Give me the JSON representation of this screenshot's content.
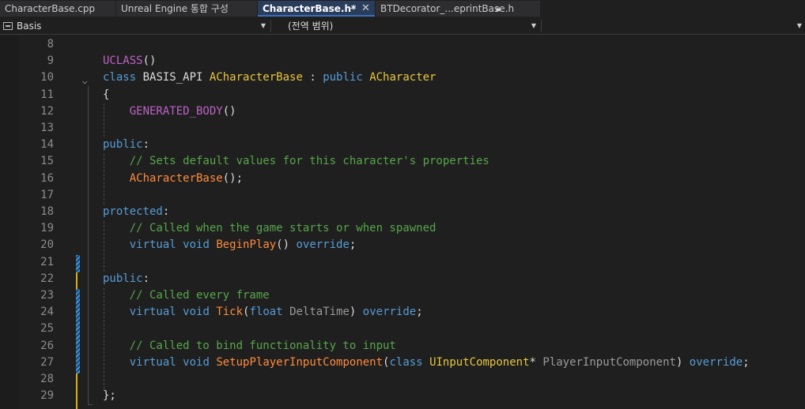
{
  "tabs": [
    {
      "label": "CharacterBase.cpp",
      "active": false
    },
    {
      "label": "Unreal Engine 통합 구성",
      "active": false
    },
    {
      "label": "CharacterBase.h*",
      "active": true
    },
    {
      "label": "BTDecorator_...eprintBase.h",
      "active": false
    }
  ],
  "tab_icons": {
    "pin": "pin-icon",
    "close": "close-icon",
    "lock": "lock-icon"
  },
  "nav": {
    "project": "Basis",
    "scope": "(전역 범위)",
    "member": ""
  },
  "code_lines": [
    {
      "n": "8",
      "tokens": []
    },
    {
      "n": "9",
      "tokens": [
        {
          "c": "mac",
          "t": "UCLASS"
        },
        {
          "c": "tx",
          "t": "()"
        }
      ]
    },
    {
      "n": "10",
      "tokens": [
        {
          "c": "kw",
          "t": "class"
        },
        {
          "c": "tx",
          "t": " BASIS_API "
        },
        {
          "c": "cls",
          "t": "ACharacterBase"
        },
        {
          "c": "tx",
          "t": " : "
        },
        {
          "c": "kw",
          "t": "public"
        },
        {
          "c": "tx",
          "t": " "
        },
        {
          "c": "cls",
          "t": "ACharacter"
        }
      ]
    },
    {
      "n": "11",
      "tokens": [
        {
          "c": "tx",
          "t": "{"
        }
      ]
    },
    {
      "n": "12",
      "tokens": [
        {
          "c": "mac",
          "t": "    GENERATED_BODY"
        },
        {
          "c": "tx",
          "t": "()"
        }
      ]
    },
    {
      "n": "13",
      "tokens": []
    },
    {
      "n": "14",
      "tokens": [
        {
          "c": "kw",
          "t": "public"
        },
        {
          "c": "tx",
          "t": ":"
        }
      ]
    },
    {
      "n": "15",
      "tokens": [
        {
          "c": "cm",
          "t": "    // Sets default values for this character's properties"
        }
      ]
    },
    {
      "n": "16",
      "tokens": [
        {
          "c": "fn",
          "t": "    ACharacterBase"
        },
        {
          "c": "tx",
          "t": "();"
        }
      ]
    },
    {
      "n": "17",
      "tokens": []
    },
    {
      "n": "18",
      "tokens": [
        {
          "c": "kw",
          "t": "protected"
        },
        {
          "c": "tx",
          "t": ":"
        }
      ]
    },
    {
      "n": "19",
      "tokens": [
        {
          "c": "cm",
          "t": "    // Called when the game starts or when spawned"
        }
      ]
    },
    {
      "n": "20",
      "tokens": [
        {
          "c": "kw",
          "t": "    virtual"
        },
        {
          "c": "tx",
          "t": " "
        },
        {
          "c": "kw",
          "t": "void"
        },
        {
          "c": "tx",
          "t": " "
        },
        {
          "c": "fn",
          "t": "BeginPlay"
        },
        {
          "c": "tx",
          "t": "() "
        },
        {
          "c": "kw",
          "t": "override"
        },
        {
          "c": "tx",
          "t": ";"
        }
      ]
    },
    {
      "n": "21",
      "tokens": []
    },
    {
      "n": "22",
      "tokens": [
        {
          "c": "kw",
          "t": "public"
        },
        {
          "c": "tx",
          "t": ":"
        }
      ]
    },
    {
      "n": "23",
      "tokens": [
        {
          "c": "cm",
          "t": "    // Called every frame"
        }
      ]
    },
    {
      "n": "24",
      "tokens": [
        {
          "c": "kw",
          "t": "    virtual"
        },
        {
          "c": "tx",
          "t": " "
        },
        {
          "c": "kw",
          "t": "void"
        },
        {
          "c": "tx",
          "t": " "
        },
        {
          "c": "fn",
          "t": "Tick"
        },
        {
          "c": "tx",
          "t": "("
        },
        {
          "c": "kw",
          "t": "float"
        },
        {
          "c": "tx",
          "t": " "
        },
        {
          "c": "prm",
          "t": "DeltaTime"
        },
        {
          "c": "tx",
          "t": ") "
        },
        {
          "c": "kw",
          "t": "override"
        },
        {
          "c": "tx",
          "t": ";"
        }
      ]
    },
    {
      "n": "25",
      "tokens": []
    },
    {
      "n": "26",
      "tokens": [
        {
          "c": "cm",
          "t": "    // Called to bind functionality to input"
        }
      ]
    },
    {
      "n": "27",
      "tokens": [
        {
          "c": "kw",
          "t": "    virtual"
        },
        {
          "c": "tx",
          "t": " "
        },
        {
          "c": "kw",
          "t": "void"
        },
        {
          "c": "tx",
          "t": " "
        },
        {
          "c": "fn",
          "t": "SetupPlayerInputComponent"
        },
        {
          "c": "tx",
          "t": "("
        },
        {
          "c": "kw",
          "t": "class"
        },
        {
          "c": "tx",
          "t": " "
        },
        {
          "c": "cls",
          "t": "UInputComponent"
        },
        {
          "c": "tx",
          "t": "* "
        },
        {
          "c": "prm",
          "t": "PlayerInputComponent"
        },
        {
          "c": "tx",
          "t": ") "
        },
        {
          "c": "kw",
          "t": "override"
        },
        {
          "c": "tx",
          "t": ";"
        }
      ]
    },
    {
      "n": "28",
      "tokens": []
    },
    {
      "n": "29",
      "tokens": [
        {
          "c": "tx",
          "t": "};"
        }
      ]
    }
  ],
  "fold_icon": "chevron-down-icon",
  "colors": {
    "keyword": "#569cd6",
    "class": "#e8c63d",
    "function": "#ff8b3d",
    "comment": "#57a64a",
    "macro": "#bd63c5",
    "saved_change": "#3b8fd9",
    "unsaved_change": "#d8b10a",
    "active_tab": "#2a3d5c"
  }
}
